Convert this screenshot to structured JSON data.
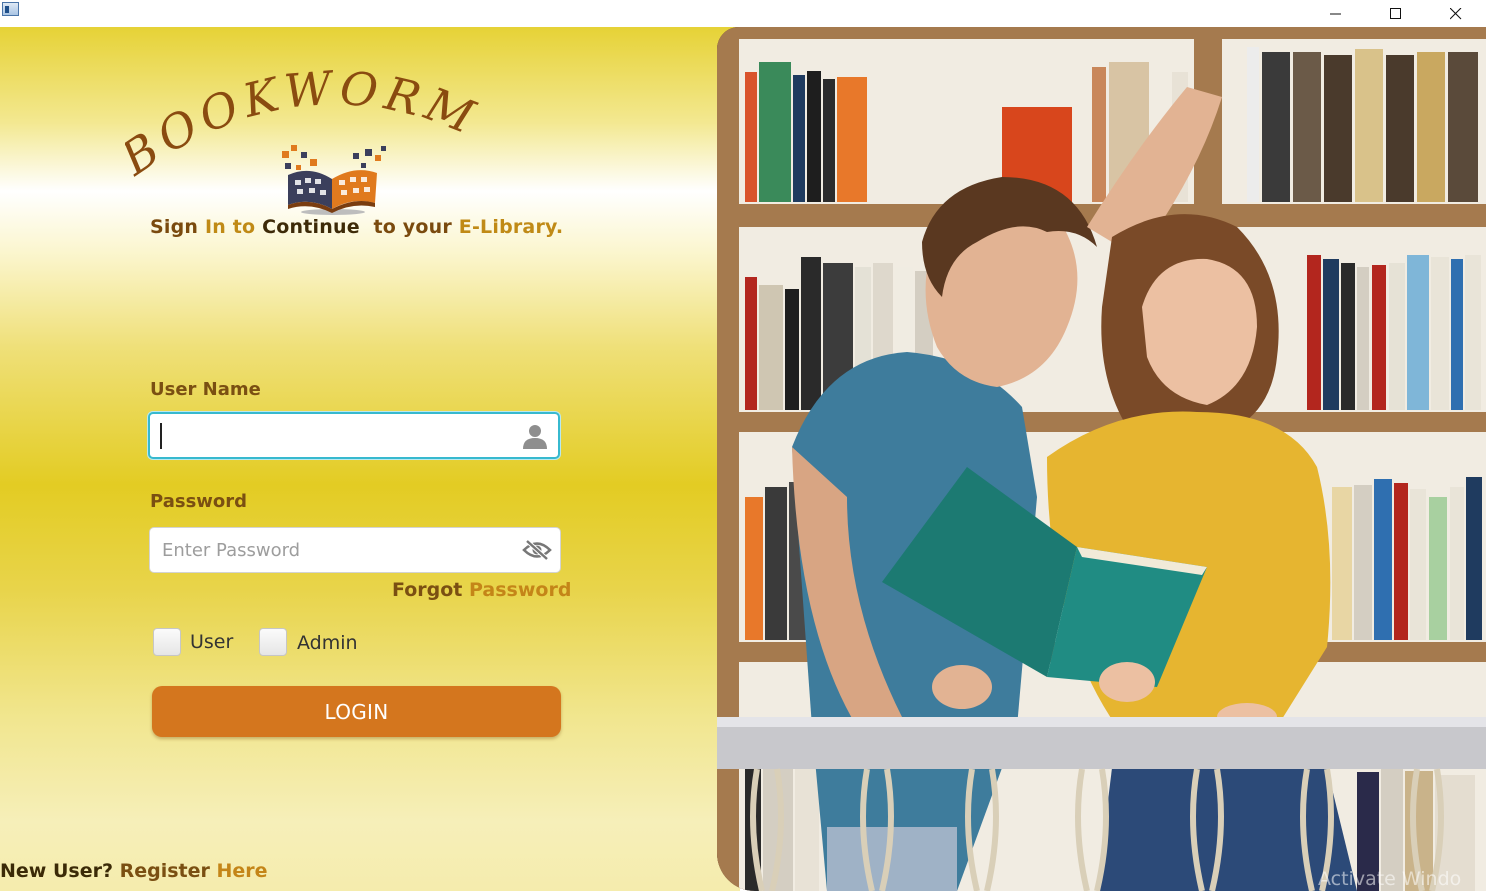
{
  "window": {
    "controls": {
      "minimize_icon": "minimize-icon",
      "maximize_icon": "maximize-icon",
      "close_icon": "close-icon"
    }
  },
  "brand": {
    "logo_text": "BOOKWORM",
    "colors": {
      "logo": "#8a4b10",
      "accent": "#d4761e",
      "label": "#7a4f12",
      "gold": "#c48518",
      "focus": "#37b9cf"
    }
  },
  "tagline": {
    "sign": "Sign",
    "in_to": "In to",
    "continue": "Continue",
    "to_your": "to your",
    "e_library": "E-Library."
  },
  "form": {
    "username_label": "User Name",
    "username_value": "",
    "username_icon": "user-icon",
    "password_label": "Password",
    "password_placeholder": "Enter Password",
    "password_icon": "eye-off-icon",
    "forgot_part1": "Forgot",
    "forgot_part2": "Password",
    "roles": [
      {
        "label": "User",
        "checked": false
      },
      {
        "label": "Admin",
        "checked": false
      }
    ],
    "login_label": "LOGIN"
  },
  "footer": {
    "new_user": "New User?",
    "register": "Register",
    "here": "Here"
  },
  "watermark": "Activate Windo"
}
